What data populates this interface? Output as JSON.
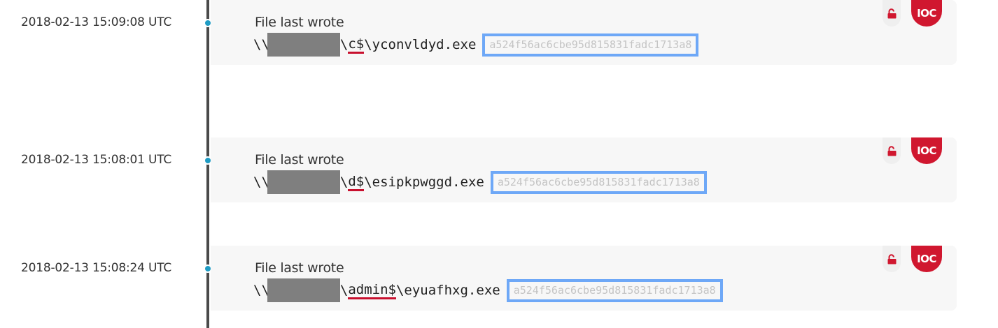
{
  "colors": {
    "timeline_dot": "#1f9cc4",
    "share_underline": "#c8102e",
    "hash_border": "#6ea8f7",
    "ioc_badge": "#d0172f",
    "lock_icon": "#d0172f"
  },
  "events": [
    {
      "timestamp": "2018-02-13 15:08:01 UTC",
      "title": "File last wrote",
      "path_prefix": "\\\\",
      "share_prefix": "\\",
      "share": "d$",
      "path_suffix": "\\esipkpwggd.exe",
      "hash": "a524f56ac6cbe95d815831fadc1713a8",
      "badge": "IOC",
      "lock_icon": "unlock-icon"
    },
    {
      "timestamp": "2018-02-13 15:08:24 UTC",
      "title": "File last wrote",
      "path_prefix": "\\\\",
      "share_prefix": "\\",
      "share": "admin$",
      "path_suffix": "\\eyuafhxg.exe",
      "hash": "a524f56ac6cbe95d815831fadc1713a8",
      "badge": "IOC",
      "lock_icon": "unlock-icon"
    },
    {
      "timestamp": "2018-02-13 15:09:08 UTC",
      "title": "File last wrote",
      "path_prefix": "\\\\",
      "share_prefix": "\\",
      "share": "c$",
      "path_suffix": "\\yconvldyd.exe",
      "hash": "a524f56ac6cbe95d815831fadc1713a8",
      "badge": "IOC",
      "lock_icon": "unlock-icon"
    }
  ]
}
